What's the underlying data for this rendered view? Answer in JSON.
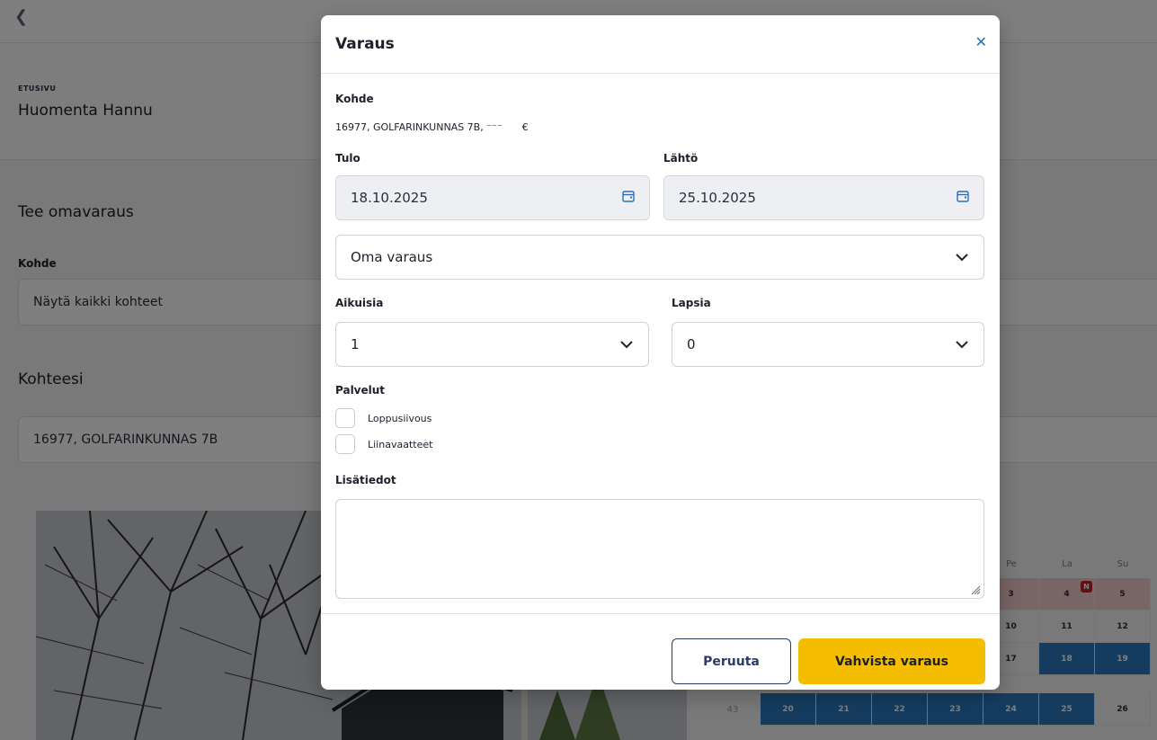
{
  "background": {
    "breadcrumb": "ETUSIVU",
    "greeting": "Huomenta Hannu",
    "own_booking_heading": "Tee omavaraus",
    "kohde_label": "Kohde",
    "kohde_select_value": "Näytä kaikki kohteet",
    "kohteesi_heading": "Kohteesi",
    "property_field_value": "16977, GOLFARINKUNNAS 7B",
    "calendar": {
      "day_headers": [
        "Pe",
        "La",
        "Su"
      ],
      "rows": [
        {
          "week": "",
          "cells": [
            {
              "d": "3",
              "s": "blocked"
            },
            {
              "d": "4",
              "s": "blocked"
            },
            {
              "d": "5",
              "s": "blocked"
            }
          ]
        },
        {
          "week": "",
          "cells": [
            {
              "d": "10",
              "s": ""
            },
            {
              "d": "11",
              "s": ""
            },
            {
              "d": "12",
              "s": ""
            }
          ]
        },
        {
          "week": "",
          "cells": [
            {
              "d": "17",
              "s": ""
            },
            {
              "d": "18",
              "s": "sel"
            },
            {
              "d": "19",
              "s": "sel"
            }
          ]
        }
      ],
      "last_row_week": "43",
      "last_row_days": [
        "20",
        "21",
        "22",
        "23",
        "24",
        "25",
        "26"
      ],
      "badge": "N"
    }
  },
  "modal": {
    "title": "Varaus",
    "close_icon": "close-icon",
    "kohde_label": "Kohde",
    "address": "16977, GOLFARINKUNNAS 7B, ⁻⁻⁻",
    "price_symbol": "€",
    "tulo_label": "Tulo",
    "tulo_value": "18.10.2025",
    "lahto_label": "Lähtö",
    "lahto_value": "25.10.2025",
    "booking_type": "Oma varaus",
    "aikuisia_label": "Aikuisia",
    "aikuisia_value": "1",
    "lapsia_label": "Lapsia",
    "lapsia_value": "0",
    "palvelut_label": "Palvelut",
    "services": [
      "Loppusiivous",
      "Liinavaatteet"
    ],
    "lisatiedot_label": "Lisätiedot",
    "lisatiedot_value": "",
    "cancel_label": "Peruuta",
    "confirm_label": "Vahvista varaus"
  },
  "colors": {
    "accent": "#f4bd00",
    "primary": "#2b3a67",
    "link": "#2e6db4",
    "calendar_selected": "#2b79bf",
    "calendar_blocked": "#f1caca"
  }
}
